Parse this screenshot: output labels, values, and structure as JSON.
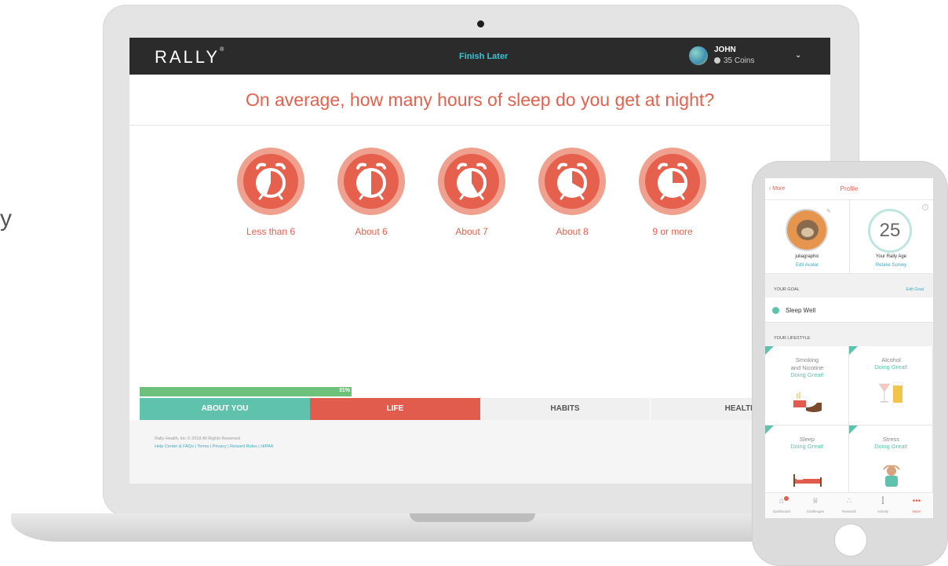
{
  "edge_text": "y",
  "desktop": {
    "logo": "RALLY",
    "logo_mark": "®",
    "finish_later": "Finish Later",
    "user": {
      "name": "JOHN",
      "coins": "35 Coins"
    },
    "question": "On average, how many hours of sleep do you get at night?",
    "options": [
      {
        "label": "Less than 6",
        "icon": "alarm-clock-icon"
      },
      {
        "label": "About 6",
        "icon": "alarm-clock-icon"
      },
      {
        "label": "About 7",
        "icon": "alarm-clock-icon"
      },
      {
        "label": "About 8",
        "icon": "alarm-clock-icon"
      },
      {
        "label": "9 or more",
        "icon": "alarm-clock-icon"
      }
    ],
    "progress": {
      "value": 31,
      "label": "31%"
    },
    "sections": [
      "ABOUT YOU",
      "LIFE",
      "HABITS",
      "HEALTH"
    ],
    "footer": {
      "copyright": "Rally Health, Inc © 2018 All Rights Reserved",
      "links": "Help Center & FAQs  |  Terms  |  Privacy  |  Reward Rules  |  HIPAA"
    }
  },
  "mobile": {
    "back": "More",
    "title": "Profile",
    "username": "juliagraphic",
    "edit_avatar": "Edit Avatar",
    "rally_age": "25",
    "rally_age_label": "Your Rally Age",
    "retake_survey": "Retake Survey",
    "your_goal": "YOUR GOAL",
    "edit_goal": "Edit Goal",
    "goal": "Sleep Well",
    "your_lifestyle": "YOUR LIFESTYLE",
    "cards": [
      {
        "title_line1": "Smoking",
        "title_line2": "and Nicotine",
        "status": "Doing Great!"
      },
      {
        "title_line1": "Alcohol",
        "title_line2": "",
        "status": "Doing Great!"
      },
      {
        "title_line1": "Sleep",
        "title_line2": "",
        "status": "Doing Great!"
      },
      {
        "title_line1": "Stress",
        "title_line2": "",
        "status": "Doing Great!"
      }
    ],
    "tabbar": [
      "Dashboard",
      "Challenges",
      "Rewards",
      "Activity",
      "More"
    ]
  },
  "colors": {
    "brand_coral": "#e1624f",
    "teal": "#5fc2ad",
    "progress_green": "#6ec17a",
    "link_blue": "#3ea8c7",
    "topbar": "#2b2b2b"
  }
}
